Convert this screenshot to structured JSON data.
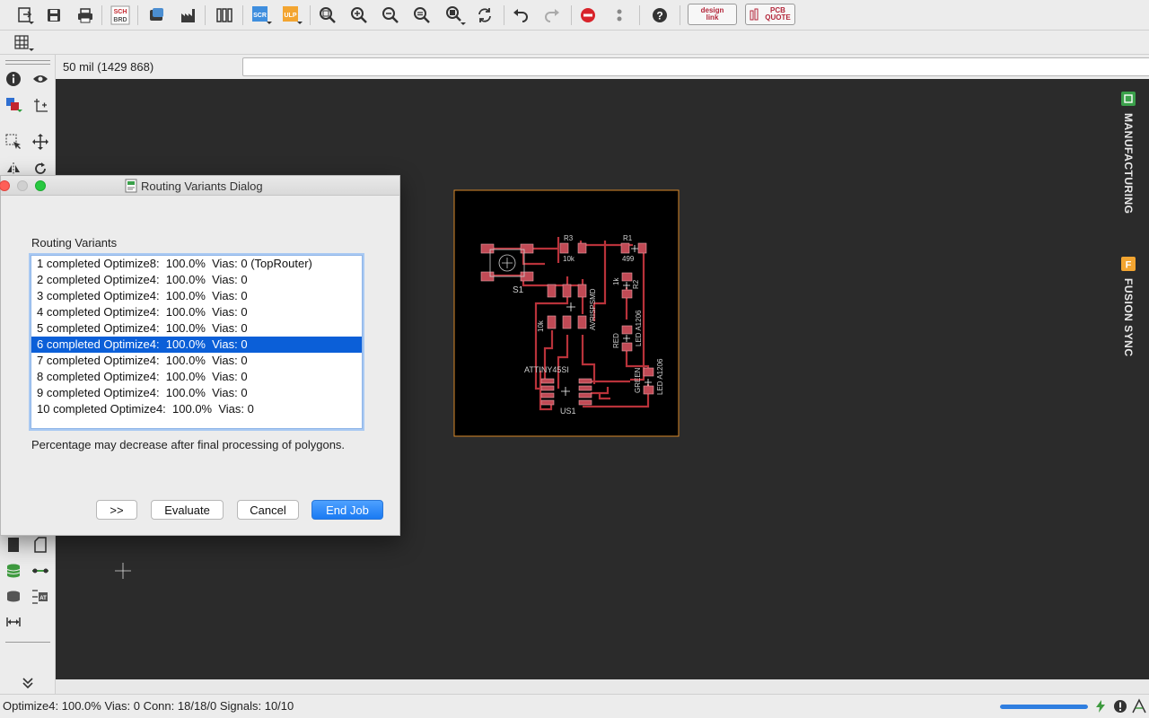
{
  "toolbar": {
    "icons": [
      "open-file-icon",
      "save-icon",
      "print-icon",
      "sch-brd-icon",
      "cam-icon",
      "manufacturing-icon",
      "library-icon",
      "script-icon",
      "ulp-icon",
      "zoom-fit-icon",
      "zoom-in-icon",
      "zoom-out-icon",
      "zoom-select-icon",
      "zoom-area-icon",
      "redraw-icon",
      "undo-icon",
      "redo-icon",
      "stop-icon",
      "go-icon",
      "help-icon"
    ],
    "sch_label": "SCH",
    "brd_label": "BRD",
    "scr_label": "SCR",
    "ulp_label": "ULP",
    "design_link_label_1": "design",
    "design_link_label_2": "link",
    "pcb_quote_label_1": "PCB",
    "pcb_quote_label_2": "QUOTE"
  },
  "coordinates": "50 mil (1429 868)",
  "command_input": "",
  "right_panel": {
    "manufacturing": "MANUFACTURING",
    "fusion_sync": "FUSION SYNC",
    "manufacturing_badge": "",
    "fusion_badge": "F"
  },
  "board": {
    "labels": {
      "s1": "S1",
      "r3": "R3",
      "r3_value": "10k",
      "r1": "R1",
      "r1_value": "499",
      "r2": "R2",
      "r2_value": "1k",
      "led_a": "LED A1206",
      "avrisp": "AVRISPSMD",
      "u_value": "10k",
      "attiny": "ATTINY45SI",
      "us1": "US1",
      "green": "GREEN",
      "led_b": "LED A1206",
      "red": "RED"
    }
  },
  "dialog": {
    "title": "Routing Variants Dialog",
    "section_label": "Routing Variants",
    "variants": [
      "1 completed Optimize8:  100.0%  Vias: 0 (TopRouter)",
      "2 completed Optimize4:  100.0%  Vias: 0",
      "3 completed Optimize4:  100.0%  Vias: 0",
      "4 completed Optimize4:  100.0%  Vias: 0",
      "5 completed Optimize4:  100.0%  Vias: 0",
      "6 completed Optimize4:  100.0%  Vias: 0",
      "7 completed Optimize4:  100.0%  Vias: 0",
      "8 completed Optimize4:  100.0%  Vias: 0",
      "9 completed Optimize4:  100.0%  Vias: 0",
      "10 completed Optimize4:  100.0%  Vias: 0"
    ],
    "selected_index": 5,
    "note": "Percentage may decrease after final processing of polygons.",
    "buttons": {
      "more": ">>",
      "evaluate": "Evaluate",
      "cancel": "Cancel",
      "end_job": "End Job"
    }
  },
  "status": {
    "text": "Optimize4: 100.0%  Vias: 0  Conn: 18/18/0  Signals: 10/10",
    "progress_fraction": 1.0
  },
  "colors": {
    "canvas_bg": "#2b2b2b",
    "board_outline": "#d8892a",
    "trace": "#b8323a",
    "pad": "#c04a55",
    "silkscreen": "#cfcfcf",
    "selection": "#0b5fd8",
    "primary_button": "#1a7af2"
  }
}
